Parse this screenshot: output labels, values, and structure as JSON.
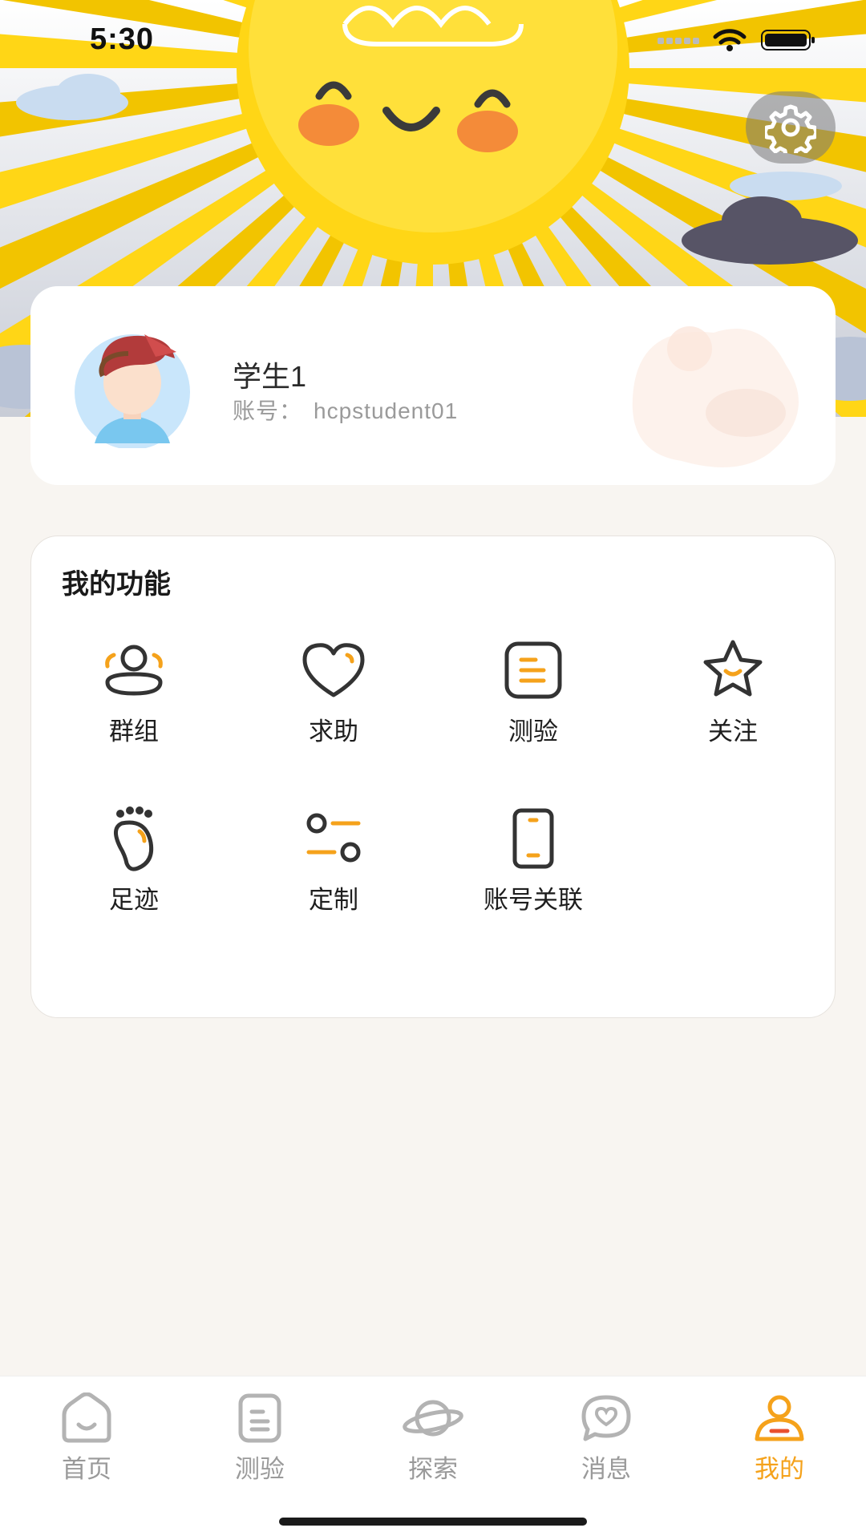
{
  "status_bar": {
    "time": "5:30",
    "icons": [
      "signal-icon",
      "wifi-icon",
      "battery-icon"
    ]
  },
  "header": {
    "settings_icon": "gear-icon"
  },
  "profile": {
    "name": "学生1",
    "account_label": "账号：",
    "account_id": "hcpstudent01",
    "avatar_icon": "boy-avatar"
  },
  "functions": {
    "title": "我的功能",
    "items": [
      {
        "label": "群组",
        "icon": "group-icon"
      },
      {
        "label": "求助",
        "icon": "heart-icon"
      },
      {
        "label": "测验",
        "icon": "quiz-icon"
      },
      {
        "label": "关注",
        "icon": "star-icon"
      },
      {
        "label": "足迹",
        "icon": "footprint-icon"
      },
      {
        "label": "定制",
        "icon": "customize-icon"
      },
      {
        "label": "账号关联",
        "icon": "phone-icon"
      }
    ]
  },
  "tabbar": {
    "active": "我的",
    "tabs": [
      {
        "label": "首页",
        "icon": "home-icon"
      },
      {
        "label": "测验",
        "icon": "quiz-icon"
      },
      {
        "label": "探索",
        "icon": "planet-icon"
      },
      {
        "label": "消息",
        "icon": "message-icon"
      },
      {
        "label": "我的",
        "icon": "profile-icon"
      }
    ]
  },
  "colors": {
    "accent": "#f5a21b",
    "sun": "#ffd616",
    "background": "#f8f5f1",
    "text": "#1e1e1e",
    "inactive": "#9a9a9a"
  }
}
